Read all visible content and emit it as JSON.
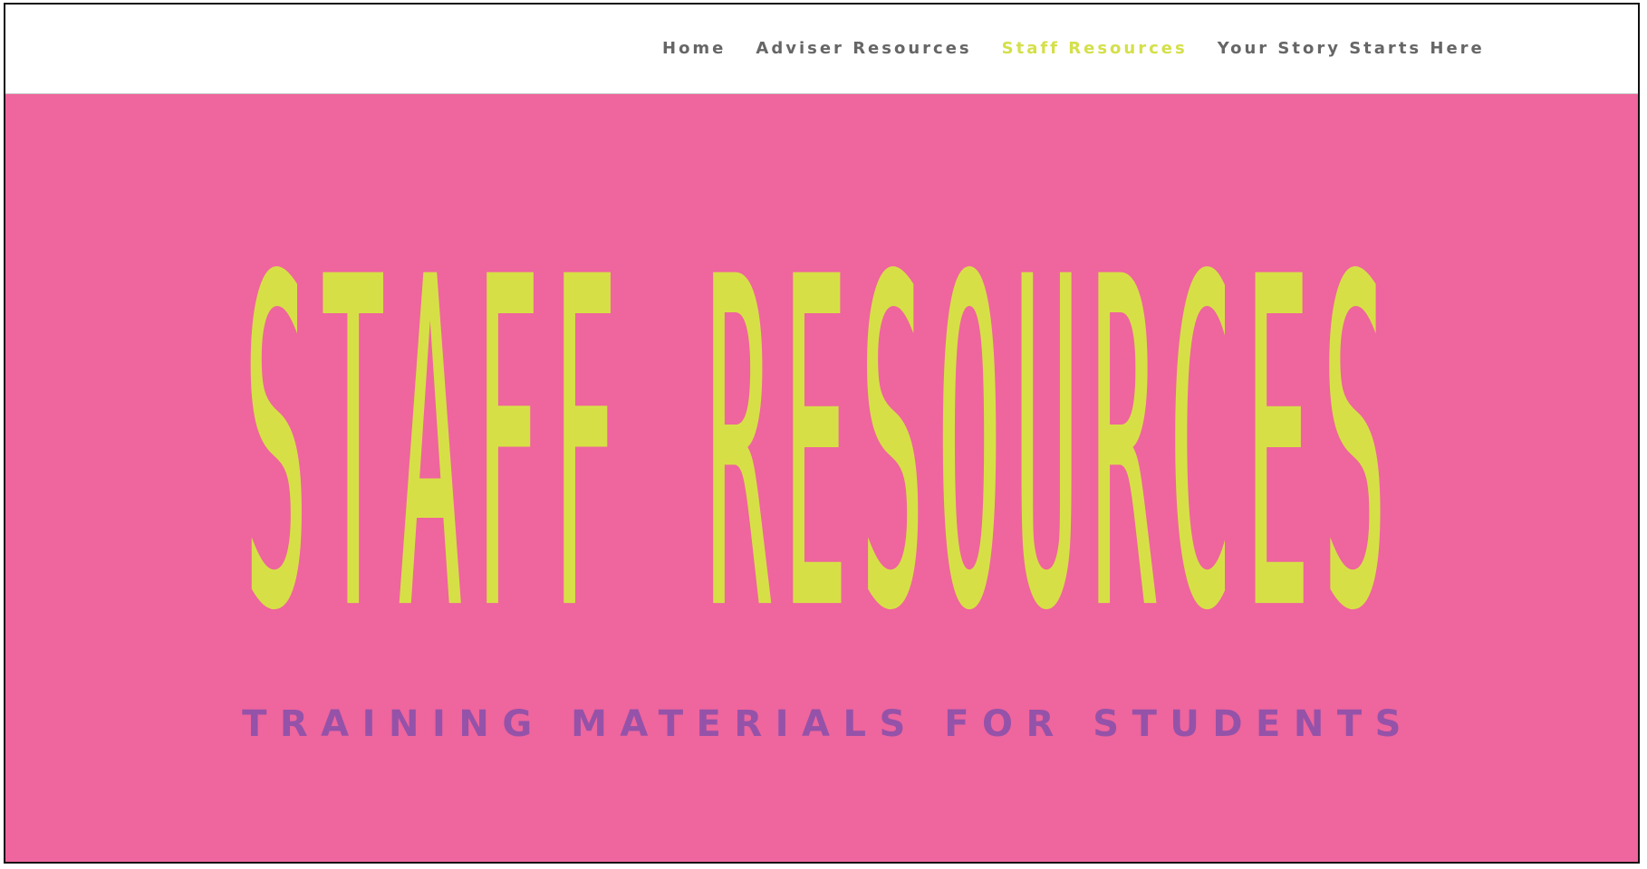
{
  "nav": {
    "items": [
      {
        "label": "Home",
        "active": false
      },
      {
        "label": "Adviser Resources",
        "active": false
      },
      {
        "label": "Staff Resources",
        "active": true
      },
      {
        "label": "Your Story Starts Here",
        "active": false
      }
    ]
  },
  "hero": {
    "title": "STAFF RESOURCES",
    "subtitle": "TRAINING MATERIALS FOR STUDENTS"
  },
  "colors": {
    "hero_background": "#ef659d",
    "title_color": "#d6e046",
    "subtitle_color": "#9552a9",
    "nav_text": "#666666",
    "nav_active": "#d4e04a"
  }
}
